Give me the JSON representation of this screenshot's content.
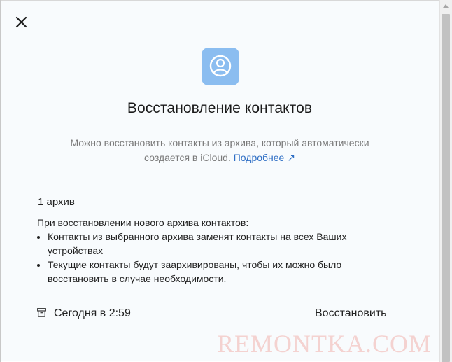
{
  "dialog": {
    "title": "Восстановление контактов",
    "description": "Можно восстановить контакты из архива, который автоматически создается в iCloud.",
    "more_link": "Подробнее",
    "more_link_arrow": "↗",
    "archive_count": "1 архив",
    "info_intro": "При восстановлении нового архива контактов:",
    "info_bullets": [
      "Контакты из выбранного архива заменят контакты на всех Ваших устройствах",
      "Текущие контакты будут заархивированы, чтобы их можно было восстановить в случае необходимости."
    ]
  },
  "archive": {
    "date": "Сегодня в 2:59",
    "restore_label": "Восстановить"
  },
  "watermark": "REMONTKA.COM",
  "icons": {
    "close": "close-icon",
    "app": "person-circle-icon",
    "archive": "archive-box-icon",
    "external": "external-link-icon"
  },
  "colors": {
    "panel_background": "#f8fbfd",
    "app_icon_background": "#8bbdf0",
    "link": "#2f6fc5",
    "muted_text": "#7a7a7a",
    "watermark": "#f4d2d0"
  }
}
